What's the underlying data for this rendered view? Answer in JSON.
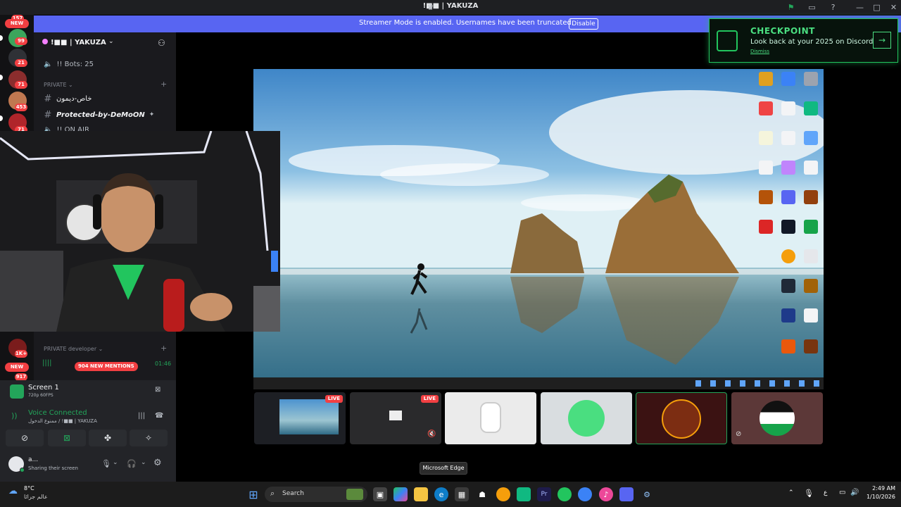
{
  "window": {
    "title": "!■■ | YAKUZA"
  },
  "banner": {
    "text": "Streamer Mode is enabled. Usernames have been truncated.",
    "button": "Disable"
  },
  "server_rail": {
    "top_badge": "157",
    "new_label": "NEW",
    "badges": [
      "99",
      "21",
      "71",
      "453",
      "71"
    ],
    "bottom_badges": [
      "1K+",
      "917"
    ]
  },
  "server": {
    "name": "!■■ | YAKUZA",
    "bots_label": "!! Bots: 25",
    "category_private": "PRIVATE",
    "channels": [
      "خاص-ديمون",
      "Protected-by-DeMoON"
    ],
    "on_air": "!! ON AIR",
    "category_developer": "PRIVATE developer",
    "mentions_badge": "904 NEW MENTIONS",
    "voice_time": "01:46",
    "new_label": "NEW"
  },
  "stream_panel": {
    "title": "Screen 1",
    "quality": "720p 60FPS",
    "voice_status": "Voice Connected",
    "voice_channel": "ممنوع الدخول / !■■ | YAKUZA",
    "user_name": "a...",
    "user_status": "Sharing their screen"
  },
  "thumbnails": {
    "live": "LIVE"
  },
  "checkpoint": {
    "title": "CHECKPOINT",
    "subtitle": "Look back at your 2025 on Discord",
    "dismiss": "Dismiss"
  },
  "tooltip": "Microsoft Edge",
  "taskbar": {
    "weather_temp": "8°C",
    "weather_loc": "عالم جرائا",
    "search": "Search",
    "time": "2:49 AM",
    "date": "1/10/2026",
    "lang": "ع"
  },
  "colors": {
    "accent": "#5865f2",
    "danger": "#f23f42",
    "green": "#23a55a",
    "checkpoint": "#4ade80"
  }
}
